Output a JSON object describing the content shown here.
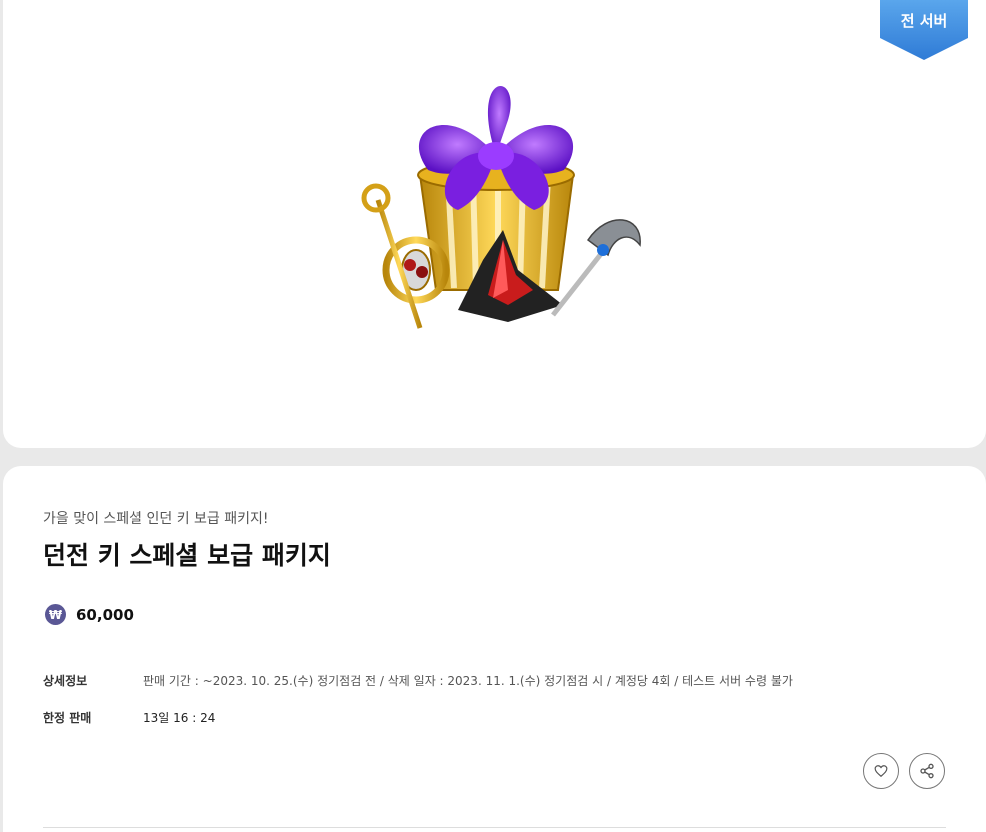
{
  "product": {
    "server_badge": "전 서버",
    "subtitle": "가을 맞이 스페셜 인던 키 보급 패키지!",
    "title": "던전 키 스페셜 보급 패키지",
    "currency_symbol": "₩",
    "price": "60,000"
  },
  "details": {
    "detail_label": "상세정보",
    "detail_value": "판매 기간 : ~2023. 10. 25.(수) 정기점검 전 / 삭제 일자 : 2023. 11. 1.(수) 정기점검 시 / 계정당 4회 / 테스트 서버 수령 불가",
    "limited_label": "한정 판매",
    "limited_value": "13일 16 : 24"
  },
  "actions": {
    "like_icon": "heart-icon",
    "share_icon": "share-icon"
  },
  "colors": {
    "badge": "#4a90e2",
    "currency_icon": "#5a5795",
    "background": "#e9e9e9"
  }
}
